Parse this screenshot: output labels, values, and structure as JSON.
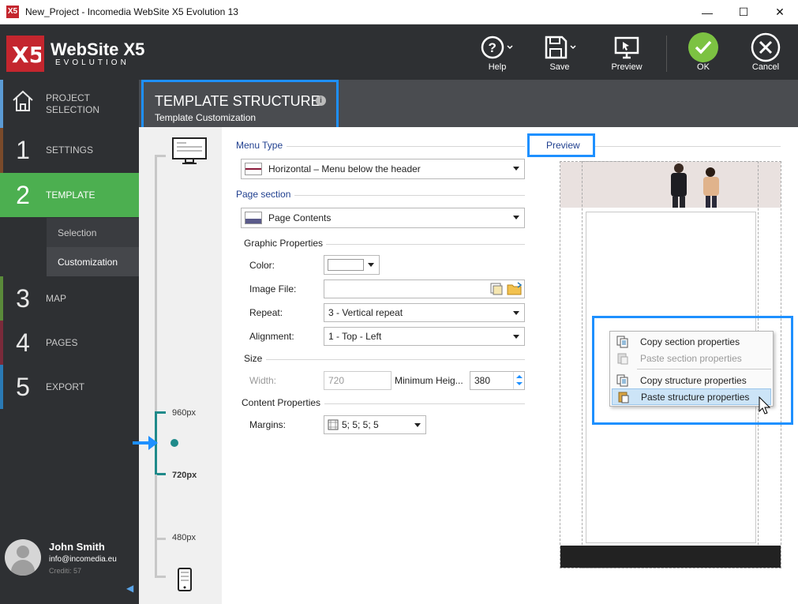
{
  "window": {
    "title": "New_Project - Incomedia WebSite X5 Evolution 13",
    "minimize": "—",
    "maximize": "☐",
    "close": "✕"
  },
  "logo": {
    "line1": "WebSite X5",
    "line2": "EVOLUTION"
  },
  "toolbar": {
    "help": "Help",
    "save": "Save",
    "preview": "Preview",
    "ok": "OK",
    "cancel": "Cancel"
  },
  "sidebar": {
    "items": [
      {
        "num": "",
        "label": "PROJECT SELECTION",
        "accent": "#5b9bd5"
      },
      {
        "num": "1",
        "label": "SETTINGS",
        "accent": "#7a4a2a"
      },
      {
        "num": "2",
        "label": "TEMPLATE",
        "accent": "#4caf50"
      },
      {
        "num": "3",
        "label": "MAP",
        "accent": "#5a8a3a"
      },
      {
        "num": "4",
        "label": "PAGES",
        "accent": "#7a2a3a"
      },
      {
        "num": "5",
        "label": "EXPORT",
        "accent": "#2a7ab5"
      }
    ],
    "sub": [
      "Selection",
      "Customization"
    ],
    "user": {
      "name": "John Smith",
      "email": "info@incomedia.eu",
      "credits": "Crediti: 57"
    }
  },
  "header": {
    "title": "TEMPLATE STRUCTURE",
    "subtitle": "Template Customization"
  },
  "slider": {
    "labels": [
      "960px",
      "720px",
      "480px"
    ],
    "selected": "720px"
  },
  "form": {
    "menu_type_label": "Menu Type",
    "menu_type_value": "Horizontal – Menu below the header",
    "preview_label": "Preview",
    "page_section_label": "Page section",
    "page_section_value": "Page Contents",
    "graphic_label": "Graphic Properties",
    "color_label": "Color:",
    "image_file_label": "Image File:",
    "image_file_value": "",
    "repeat_label": "Repeat:",
    "repeat_value": "3 - Vertical repeat",
    "alignment_label": "Alignment:",
    "alignment_value": "1 - Top - Left",
    "size_label": "Size",
    "width_label": "Width:",
    "width_value": "720",
    "min_height_label": "Minimum Heig...",
    "min_height_value": "380",
    "content_label": "Content Properties",
    "margins_label": "Margins:",
    "margins_value": "5; 5; 5; 5"
  },
  "context_menu": {
    "items": [
      {
        "label": "Copy section properties",
        "enabled": true
      },
      {
        "label": "Paste section properties",
        "enabled": false
      },
      {
        "label": "Copy structure properties",
        "enabled": true
      },
      {
        "label": "Paste structure properties",
        "enabled": true,
        "highlighted": true
      }
    ]
  },
  "colors": {
    "accent_blue": "#1e90ff",
    "ok_green": "#7cc242",
    "active_green": "#4caf50",
    "teal": "#1f8a8a"
  }
}
